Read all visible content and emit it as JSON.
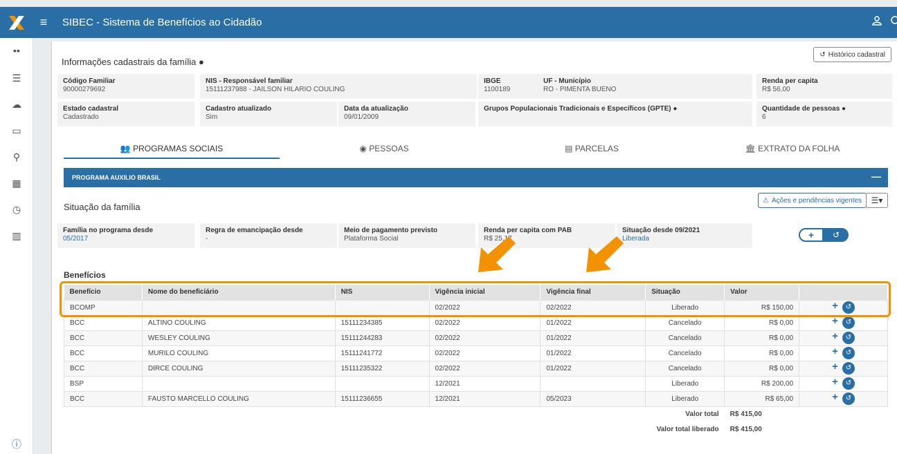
{
  "header": {
    "app_title": "SIBEC - Sistema de Benefícios ao Cidadão",
    "menu_icon": "hamburger-icon",
    "user_icon": "user-icon"
  },
  "rail_icons": [
    "grid-icon",
    "list-icon",
    "cloud-icon",
    "folder-icon",
    "search-icon",
    "calendar-icon",
    "alarm-icon",
    "building-icon",
    "info-icon"
  ],
  "family_info": {
    "title": "Informações cadastrais da família",
    "history_button": "Histórico cadastral",
    "fields": [
      {
        "label": "Código Familiar",
        "value": "90000279692"
      },
      {
        "label": "NIS - Responsável familiar",
        "value": "15111237988 - JAILSON HILARIO COULING"
      },
      {
        "label": "IBGE",
        "value": "1100189"
      },
      {
        "label": "UF - Município",
        "value": "RO - PIMENTA BUENO"
      },
      {
        "label": "Renda per capita",
        "value": "R$ 56,00"
      },
      {
        "label": "Estado cadastral",
        "value": "Cadastrado"
      },
      {
        "label": "Cadastro atualizado",
        "value": "Sim"
      },
      {
        "label": "Data da atualização",
        "value": "09/01/2009"
      },
      {
        "label": "Grupos Populacionais Tradicionais e Específicos (GPTE)",
        "value": ""
      },
      {
        "label": "Quantidade de pessoas",
        "value": "6"
      }
    ]
  },
  "tabs": [
    {
      "label": "PROGRAMAS SOCIAIS",
      "active": true
    },
    {
      "label": "PESSOAS",
      "active": false
    },
    {
      "label": "PARCELAS",
      "active": false
    },
    {
      "label": "EXTRATO DA FOLHA",
      "active": false
    }
  ],
  "program": {
    "name": "PROGRAMA AUXILIO BRASIL",
    "situation_title": "Situação da família",
    "acoes_button": "Ações e pendências vigentes",
    "fields": [
      {
        "label": "Família no programa desde",
        "value": "05/2017"
      },
      {
        "label": "Regra de emancipação desde",
        "value": "-"
      },
      {
        "label": "Meio de pagamento previsto",
        "value": "Plataforma Social"
      },
      {
        "label": "Renda per capita com PAB",
        "value": "R$ 25,17"
      },
      {
        "label": "Situação desde 09/2021",
        "value": "Liberada"
      }
    ]
  },
  "benefits": {
    "title": "Benefícios",
    "columns": [
      "Benefício",
      "Nome do beneficiário",
      "NIS",
      "Vigência inicial",
      "Vigência final",
      "Situação",
      "Valor",
      ""
    ],
    "rows": [
      [
        "BCOMP",
        "",
        "",
        "02/2022",
        "02/2022",
        "Liberado",
        "R$ 150,00"
      ],
      [
        "BCC",
        "ALTINO COULING",
        "15111234385",
        "02/2022",
        "01/2022",
        "Cancelado",
        "R$ 0,00"
      ],
      [
        "BCC",
        "WESLEY COULING",
        "15111244283",
        "02/2022",
        "01/2022",
        "Cancelado",
        "R$ 0,00"
      ],
      [
        "BCC",
        "MURILO COULING",
        "15111241772",
        "02/2022",
        "01/2022",
        "Cancelado",
        "R$ 0,00"
      ],
      [
        "BCC",
        "DIRCE COULING",
        "15111235322",
        "02/2022",
        "01/2022",
        "Cancelado",
        "R$ 0,00"
      ],
      [
        "BSP",
        "",
        "",
        "12/2021",
        "",
        "Liberado",
        "R$ 200,00"
      ],
      [
        "BCC",
        "FAUSTO MARCELLO COULING",
        "15111236655",
        "12/2021",
        "05/2023",
        "Liberado",
        "R$ 65,00"
      ]
    ],
    "total_label": "Valor total",
    "total_value": "R$ 415,00",
    "total_released_label": "Valor total liberado",
    "total_released_value": "R$ 415,00"
  },
  "colors": {
    "primary": "#2a6ea6",
    "highlight": "#f39200"
  }
}
